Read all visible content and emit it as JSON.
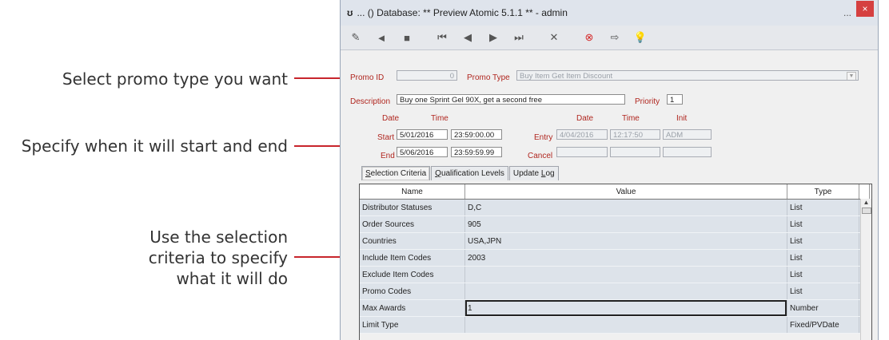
{
  "callouts": [
    {
      "text": "Select promo type you want"
    },
    {
      "text": "Specify when it will start and end"
    },
    {
      "lines": [
        "Use the selection",
        "criteria to specify",
        "what it will do"
      ]
    }
  ],
  "window": {
    "icon": "ʊ",
    "title": "... () Database: ** Preview Atomic 5.1.1 ** - admin",
    "minimize": "...",
    "close": "×"
  },
  "toolbar": {
    "icons": [
      "new-icon",
      "back-icon",
      "save-icon",
      "first-record-icon",
      "prev-record-icon",
      "next-record-icon",
      "last-record-icon",
      "delete-icon",
      "cancel-icon",
      "exit-icon",
      "help-icon"
    ],
    "glyphs": [
      "✎",
      "◄",
      "■",
      "⏮",
      "◀",
      "▶",
      "⏭",
      "✕",
      "⊗",
      "⇨",
      "💡"
    ],
    "colors": {
      "cancel": "#d42a2a",
      "help": "#e8c41a"
    }
  },
  "form": {
    "promo_id_label": "Promo ID",
    "promo_id_value": "0",
    "promo_type_label": "Promo Type",
    "promo_type_value": "Buy Item Get Item Discount",
    "description_label": "Description",
    "description_value": "Buy one Sprint Gel 90X, get a second free",
    "priority_label": "Priority",
    "priority_value": "1",
    "date_header": "Date",
    "time_header": "Time",
    "init_header": "Init",
    "start_label": "Start",
    "start_date": "5/01/2016",
    "start_time": "23:59:00.00",
    "end_label": "End",
    "end_date": "5/06/2016",
    "end_time": "23:59:59.99",
    "entry_label": "Entry",
    "entry_date": "4/04/2016",
    "entry_time": "12:17:50",
    "entry_init": "ADM",
    "cancel_label": "Cancel",
    "cancel_date": "",
    "cancel_time": "",
    "cancel_init": ""
  },
  "tabs": [
    {
      "prefix": "",
      "accel": "S",
      "rest": "election Criteria",
      "active": true
    },
    {
      "prefix": "",
      "accel": "Q",
      "rest": "ualification Levels",
      "active": false
    },
    {
      "prefix": "Update ",
      "accel": "L",
      "rest": "og",
      "active": false
    }
  ],
  "grid": {
    "columns": [
      "Name",
      "Value",
      "Type"
    ],
    "rows": [
      {
        "name": "Distributor Statuses",
        "value": "D,C",
        "type": "List"
      },
      {
        "name": "Order Sources",
        "value": "905",
        "type": "List"
      },
      {
        "name": "Countries",
        "value": "USA,JPN",
        "type": "List"
      },
      {
        "name": "Include Item Codes",
        "value": "2003",
        "type": "List"
      },
      {
        "name": "Exclude Item Codes",
        "value": "",
        "type": "List"
      },
      {
        "name": "Promo Codes",
        "value": "",
        "type": "List"
      },
      {
        "name": "Max Awards",
        "value": "1",
        "type": "Number"
      },
      {
        "name": "Limit Type",
        "value": "",
        "type": "Fixed/PVDate"
      }
    ]
  },
  "colors": {
    "callout_line": "#c8252c",
    "label": "#b0261f",
    "row_bg": "#dde3ea"
  }
}
